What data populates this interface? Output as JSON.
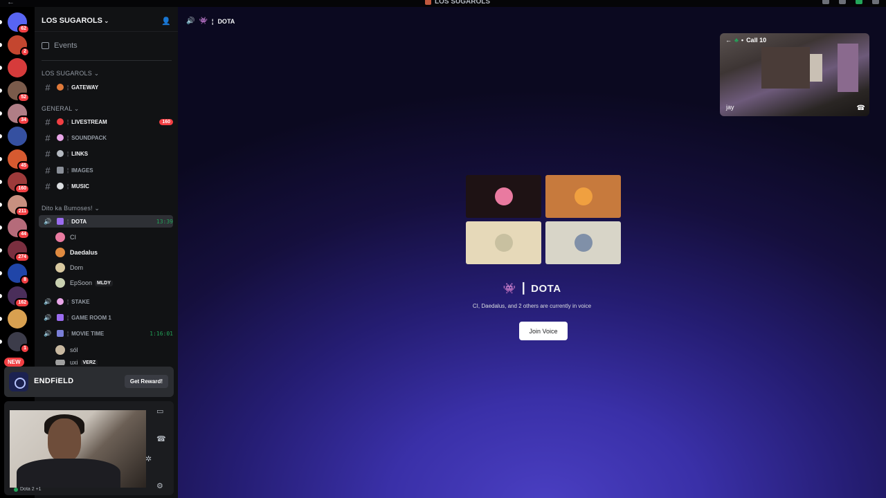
{
  "window": {
    "title": "LOS SUGAROLS"
  },
  "rail": {
    "new_badge": "NEW",
    "guilds": [
      {
        "badge": "62",
        "color": "#5865f2"
      },
      {
        "badge": "2",
        "color": "#c4462f"
      },
      {
        "badge": "",
        "color": "#d63b3b"
      },
      {
        "badge": "52",
        "color": "#7a5b4b"
      },
      {
        "badge": "34",
        "color": "#b07e86"
      },
      {
        "badge": "",
        "color": "#3550a0"
      },
      {
        "badge": "45",
        "color": "#d65a30"
      },
      {
        "badge": "160",
        "color": "#9c3a3a"
      },
      {
        "badge": "211",
        "color": "#c89080"
      },
      {
        "badge": "44",
        "color": "#b56b7a"
      },
      {
        "badge": "274",
        "color": "#7a2f3f"
      },
      {
        "badge": "8",
        "color": "#2045a8"
      },
      {
        "badge": "162",
        "color": "#4a2e5a"
      },
      {
        "badge": "",
        "color": "#d8a050"
      },
      {
        "badge": "1",
        "color": "#3c3c4a"
      }
    ]
  },
  "sidebar": {
    "server_name": "LOS SUGAROLS",
    "events_label": "Events",
    "categories": [
      "LOS SUGAROLS",
      "GENERAL",
      "Dito ka Bumoses!"
    ],
    "channels": [
      {
        "name": "GATEWAY",
        "emoji_color": "#e07a3a",
        "unread": true
      },
      {
        "name": "LIVESTREAM",
        "emoji_color": "#f23f43",
        "unread": true,
        "count": "160"
      },
      {
        "name": "SOUNDPACK",
        "emoji_color": "#e9a6e8",
        "unread": false
      },
      {
        "name": "LINKS",
        "emoji_color": "#b5bac1",
        "unread": true
      },
      {
        "name": "IMAGES",
        "emoji_color": "#8a8f98",
        "unread": false
      },
      {
        "name": "MUSIC",
        "emoji_color": "#dbdee1",
        "unread": true
      }
    ],
    "voice_channels": [
      {
        "name": "DOTA",
        "time": "13:39"
      },
      {
        "name": "STAKE"
      },
      {
        "name": "GAME ROOM 1"
      },
      {
        "name": "MOVIE TIME",
        "time": "1:16:01"
      }
    ],
    "dota_users": [
      {
        "name": "CI",
        "color": "#e97aa0"
      },
      {
        "name": "Daedalus",
        "color": "#e08a40",
        "bold": true
      },
      {
        "name": "Dom",
        "color": "#d9c9a0"
      },
      {
        "name": "EpSoon",
        "color": "#c8d0b0",
        "tag": "MLDY"
      }
    ],
    "movie_users": [
      {
        "name": "sól",
        "color": "#c8b8a0"
      },
      {
        "name": "uxi",
        "color": "#a0a0a0",
        "tag": "VERZ"
      }
    ]
  },
  "promo": {
    "name": "ENDFiELD",
    "button": "Get Reward!"
  },
  "status": {
    "activity": "Dota 2 +1"
  },
  "main": {
    "channel_name": "DOTA",
    "title": "DOTA",
    "subtitle": "CI, Daedalus, and 2 others are currently in voice",
    "join_button": "Join Voice",
    "tiles": [
      {
        "bg": "#1e1214",
        "avatar": "#e97aa0"
      },
      {
        "bg": "#c77a3d",
        "avatar": "#f0a040"
      },
      {
        "bg": "#e6d9b9",
        "avatar": "#c8c0a0"
      },
      {
        "bg": "#d8d5c8",
        "avatar": "#8090a8"
      }
    ]
  },
  "call": {
    "title": "Call 10",
    "participant": "jay"
  }
}
